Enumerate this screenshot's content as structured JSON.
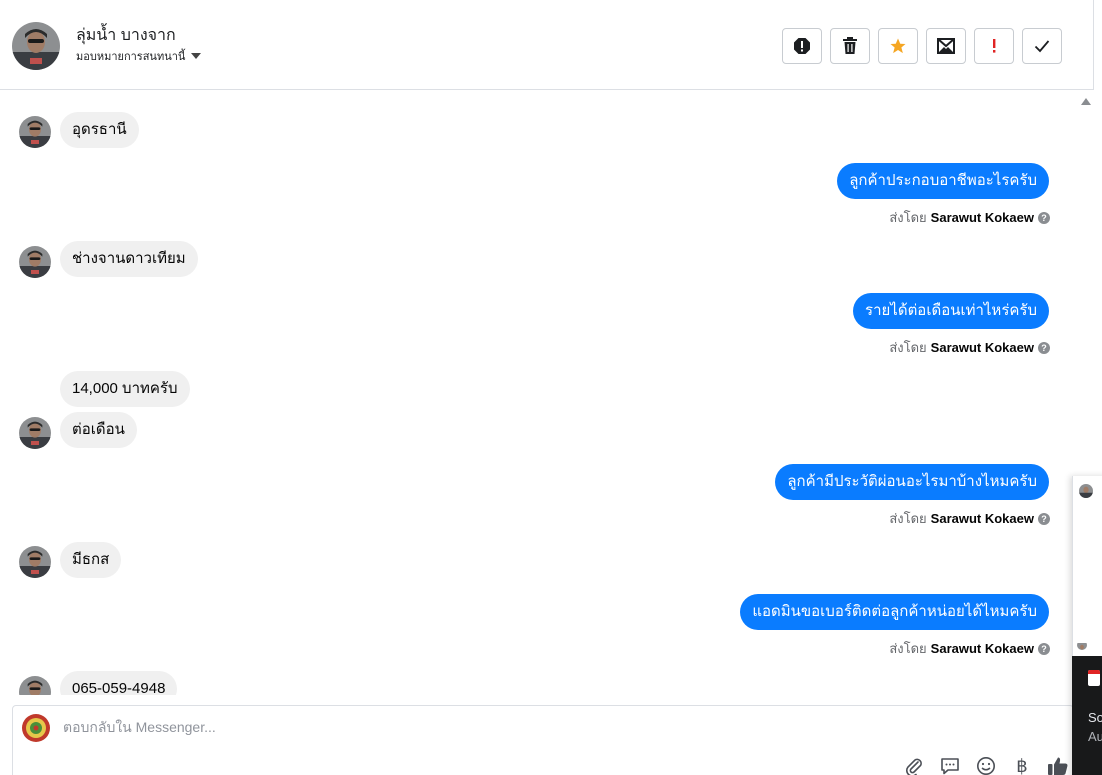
{
  "header": {
    "contact_name": "ลุ่มน้ำ บางจาก",
    "assign_label": "มอบหมายการสนทนานี้",
    "toolbar": [
      {
        "name": "spam",
        "icon": "alert-octagon-icon",
        "color": "#1c1e21"
      },
      {
        "name": "delete",
        "icon": "trash-icon",
        "color": "#1c1e21"
      },
      {
        "name": "star",
        "icon": "star-icon",
        "color": "#f5a623"
      },
      {
        "name": "mark-unread",
        "icon": "envelope-icon",
        "color": "#1c1e21"
      },
      {
        "name": "flag-important",
        "icon": "exclamation-icon",
        "color": "#e02424"
      },
      {
        "name": "mark-done",
        "icon": "check-icon",
        "color": "#1c1e21"
      }
    ]
  },
  "messages": [
    {
      "dir": "in",
      "text": "อุดรธานี"
    },
    {
      "dir": "out",
      "text": "ลูกค้าประกอบอาชีพอะไรครับ",
      "sent_by_prefix": "ส่งโดย",
      "sender": "Sarawut Kokaew"
    },
    {
      "dir": "in",
      "text": "ช่างจานดาวเทียม"
    },
    {
      "dir": "out",
      "text": "รายได้ต่อเดือนเท่าไหร่ครับ",
      "sent_by_prefix": "ส่งโดย",
      "sender": "Sarawut Kokaew"
    },
    {
      "dir": "in",
      "text": "14,000 บาทครับ"
    },
    {
      "dir": "in",
      "text": "ต่อเดือน"
    },
    {
      "dir": "out",
      "text": "ลูกค้ามีประวัติผ่อนอะไรมาบ้างไหมครับ",
      "sent_by_prefix": "ส่งโดย",
      "sender": "Sarawut Kokaew"
    },
    {
      "dir": "in",
      "text": "มีธกส"
    },
    {
      "dir": "out",
      "text": "แอดมินขอเบอร์ติดต่อลูกค้าหน่อยได้ไหมครับ",
      "sent_by_prefix": "ส่งโดย",
      "sender": "Sarawut Kokaew"
    },
    {
      "dir": "in",
      "text": "065-059-4948"
    }
  ],
  "composer": {
    "placeholder": "ตอบกลับใน Messenger...",
    "tools": [
      "paperclip-icon",
      "saved-reply-icon",
      "emoji-icon",
      "baht-icon",
      "thumbs-up-icon"
    ],
    "baht_symbol": "฿"
  },
  "side_popup": {
    "line1": "So",
    "line2": "Au"
  },
  "colors": {
    "outgoing_bubble": "#0a7cff",
    "incoming_bubble": "#f0f0f0",
    "accent_star": "#f5a623",
    "accent_red": "#e02424"
  }
}
